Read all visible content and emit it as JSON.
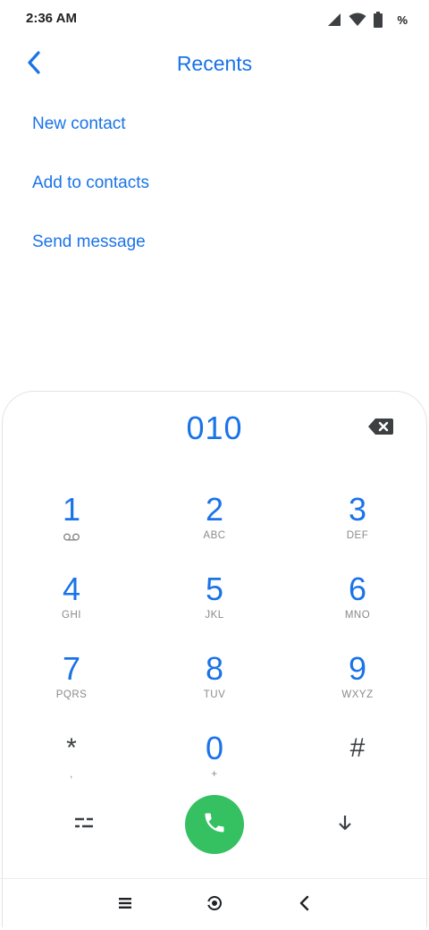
{
  "status_bar": {
    "time": "2:36 AM",
    "battery_percent": "%",
    "icons": [
      "signal-icon",
      "wifi-icon",
      "battery-icon"
    ]
  },
  "header": {
    "title": "Recents",
    "back_icon": "chevron-left-icon"
  },
  "options": [
    {
      "label": "New contact"
    },
    {
      "label": "Add to contacts"
    },
    {
      "label": "Send message"
    }
  ],
  "dialpad": {
    "number": "010",
    "backspace_icon": "backspace-icon",
    "keys": [
      {
        "digit": "1",
        "letters": "",
        "sub_icon": "voicemail-icon"
      },
      {
        "digit": "2",
        "letters": "ABC"
      },
      {
        "digit": "3",
        "letters": "DEF"
      },
      {
        "digit": "4",
        "letters": "GHI"
      },
      {
        "digit": "5",
        "letters": "JKL"
      },
      {
        "digit": "6",
        "letters": "MNO"
      },
      {
        "digit": "7",
        "letters": "PQRS"
      },
      {
        "digit": "8",
        "letters": "TUV"
      },
      {
        "digit": "9",
        "letters": "WXYZ"
      },
      {
        "digit": "*",
        "letters": ","
      },
      {
        "digit": "0",
        "letters": "+"
      },
      {
        "digit": "#",
        "letters": ""
      }
    ]
  },
  "actions": {
    "options_icon": "dialpad-options-icon",
    "call_icon": "phone-icon",
    "collapse_icon": "arrow-down-icon"
  },
  "nav_bar": {
    "icons": [
      "recents-apps-icon",
      "home-icon",
      "back-icon"
    ]
  },
  "colors": {
    "accent": "#1a73e8",
    "call": "#35c061",
    "secondary_text": "#8a8a8a"
  }
}
